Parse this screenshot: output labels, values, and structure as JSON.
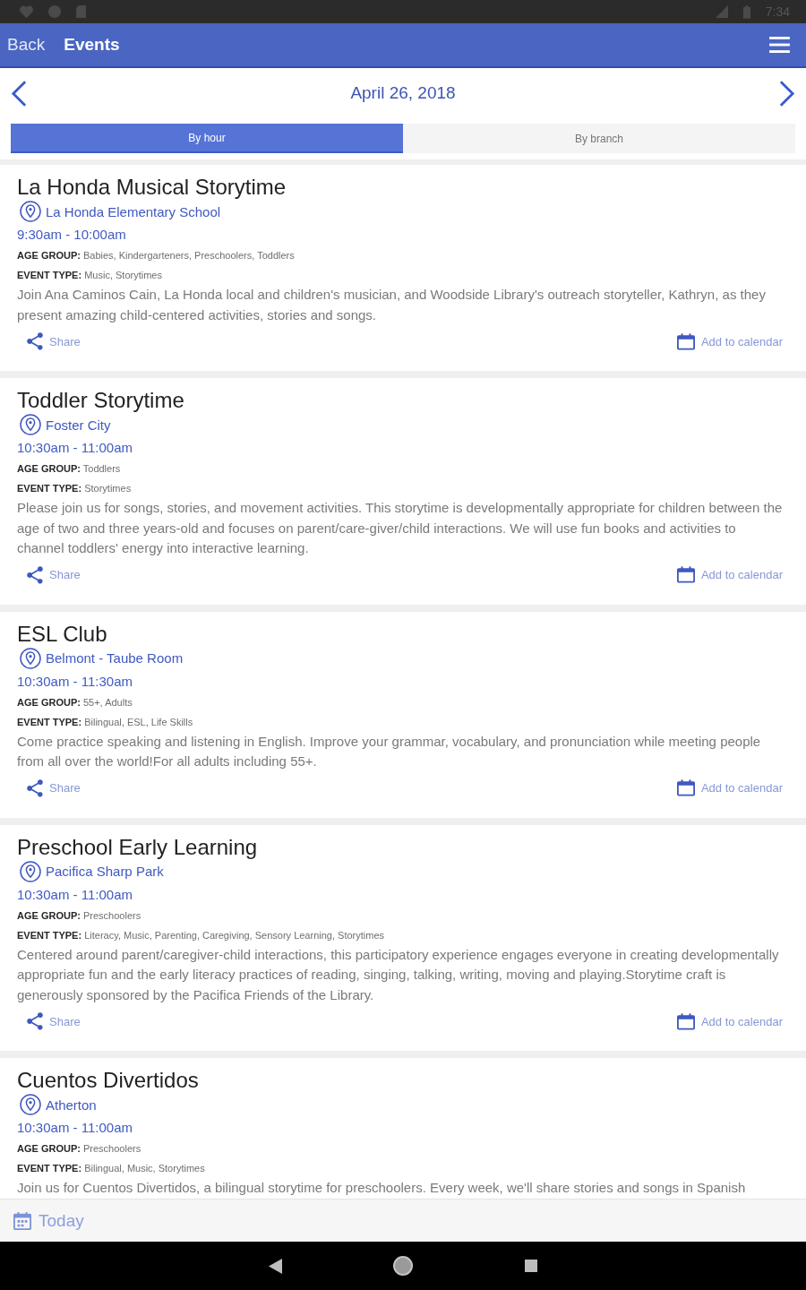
{
  "status_bar": {
    "time": "7:34"
  },
  "app_bar": {
    "back_label": "Back",
    "title": "Events"
  },
  "date_nav": {
    "date": "April 26, 2018"
  },
  "view_tabs": [
    {
      "label": "By hour",
      "selected": true
    },
    {
      "label": "By branch",
      "selected": false
    }
  ],
  "events": [
    {
      "title": "La Honda Musical Storytime",
      "location": "La Honda Elementary School",
      "time": "9:30am - 10:00am",
      "age_group": "**AGE GROUP:** Babies, Kindergarteners, Preschoolers, Toddlers",
      "event_type": "**EVENT TYPE:** Music, Storytimes",
      "description": "Join Ana Caminos Cain, La Honda local and children's musician, and Woodside Library's outreach storyteller, Kathryn, as they present amazing child-centered activities, stories and songs.",
      "share_label": "Share",
      "calendar_label": "Add to calendar"
    },
    {
      "title": "Toddler Storytime",
      "location": "Foster City",
      "time": "10:30am - 11:00am",
      "age_group": "**AGE GROUP:** Toddlers",
      "event_type": "**EVENT TYPE:** Storytimes",
      "description": "Please join us for songs, stories, and movement activities. This storytime is developmentally appropriate for children between the age of two and three years-old and focuses on parent/care-giver/child interactions. We will use fun books and activities to channel toddlers' energy into interactive learning.",
      "share_label": "Share",
      "calendar_label": "Add to calendar"
    },
    {
      "title": "ESL Club",
      "location": "Belmont - Taube Room",
      "time": "10:30am - 11:30am",
      "age_group": "**AGE GROUP:** 55+, Adults",
      "event_type": "**EVENT TYPE:** Bilingual, ESL, Life Skills",
      "description": "Come practice speaking and listening in English. Improve your grammar, vocabulary, and pronunciation while meeting people from all over the world!For all adults including 55+.",
      "share_label": "Share",
      "calendar_label": "Add to calendar"
    },
    {
      "title": "Preschool Early Learning",
      "location": "Pacifica Sharp Park",
      "time": "10:30am - 11:00am",
      "age_group": "**AGE GROUP:** Preschoolers",
      "event_type": "**EVENT TYPE:** Literacy, Music, Parenting, Caregiving, Sensory Learning, Storytimes",
      "description": "Centered around parent/caregiver-child interactions, this participatory experience engages everyone in creating developmentally appropriate fun and the early literacy practices of reading, singing, talking, writing, moving and playing.Storytime craft is generously sponsored by the Pacifica Friends of the Library.",
      "share_label": "Share",
      "calendar_label": "Add to calendar"
    },
    {
      "title": "Cuentos Divertidos",
      "location": "Atherton",
      "time": "10:30am - 11:00am",
      "age_group": "**AGE GROUP:** Preschoolers",
      "event_type": "**EVENT TYPE:** Bilingual, Music, Storytimes",
      "description": "Join us for Cuentos Divertidos, a bilingual storytime for preschoolers. Every week, we'll share stories and songs in Spanish"
    }
  ],
  "footer": {
    "today_label": "Today"
  }
}
